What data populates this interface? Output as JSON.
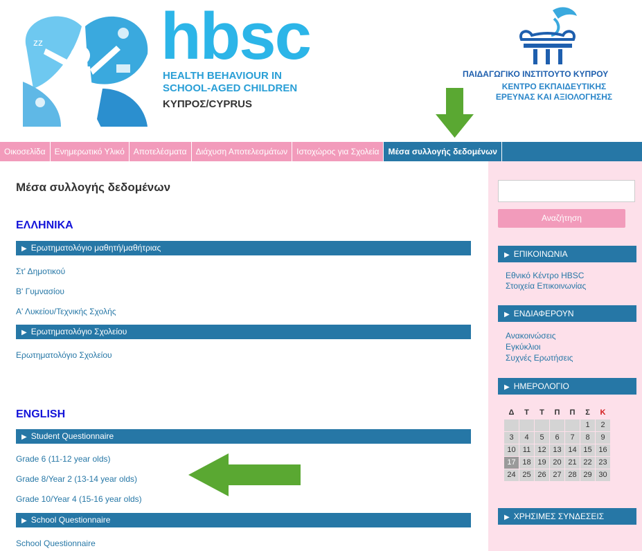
{
  "header": {
    "hbsc_word": "hbsc",
    "hbsc_sub1": "HEALTH BEHAVIOUR IN",
    "hbsc_sub2": "SCHOOL-AGED CHILDREN",
    "hbsc_country": "ΚΥΠΡΟΣ/CYPRUS",
    "pi_line1": "ΠΑΙΔΑΓΩΓΙΚΟ ΙΝΣΤΙΤΟΥΤΟ ΚΥΠΡΟΥ",
    "pi_line2": "ΚΕΝΤΡΟ ΕΚΠΑΙΔΕΥΤΙΚΗΣ",
    "pi_line3": "ΕΡΕΥΝΑΣ ΚΑΙ ΑΞΙΟΛΟΓΗΣΗΣ"
  },
  "nav": {
    "items": [
      {
        "label": "Οικοσελίδα"
      },
      {
        "label": "Ενημερωτικό Υλικό"
      },
      {
        "label": "Αποτελέσματα"
      },
      {
        "label": "Διάχυση Αποτελεσμάτων"
      },
      {
        "label": "Ιστοχώρος για Σχολεία"
      },
      {
        "label": "Μέσα συλλογής δεδομένων"
      }
    ]
  },
  "main": {
    "title": "Μέσα συλλογής δεδομένων",
    "greek": {
      "heading": "ΕΛΛΗΝΙΚΑ",
      "bar1": "Ερωτηματολόγιο μαθητή/μαθήτριας",
      "links1": [
        "Στ' Δημοτικού",
        "Β' Γυμνασίου",
        "Α' Λυκείου/Τεχνικής Σχολής"
      ],
      "bar2": "Ερωτηματολόγιο Σχολείου",
      "links2": [
        "Ερωτηματολόγιο Σχολείου"
      ]
    },
    "english": {
      "heading": "ENGLISH",
      "bar1": "Student Questionnaire",
      "links1": [
        "Grade 6 (11-12 year olds)",
        "Grade 8/Year 2 (13-14 year olds)",
        "Grade 10/Year 4 (15-16 year olds)"
      ],
      "bar2": "School Questionnaire",
      "links2": [
        "School Questionnaire"
      ]
    }
  },
  "sidebar": {
    "search_button": "Αναζήτηση",
    "contact": {
      "title": "ΕΠΙΚΟΙΝΩΝΙΑ",
      "links": [
        "Εθνικό Κέντρο HBSC",
        "Στοιχεία Επικοινωνίας"
      ]
    },
    "interest": {
      "title": "ΕΝΔΙΑΦΕΡΟΥΝ",
      "links": [
        "Ανακοινώσεις",
        "Εγκύκλιοι",
        "Συχνές Ερωτήσεις"
      ]
    },
    "calendar": {
      "title": "ΗΜΕΡΟΛΟΓΙΟ",
      "days": [
        "Δ",
        "Τ",
        "Τ",
        "Π",
        "Π",
        "Σ",
        "Κ"
      ],
      "weeks": [
        [
          "",
          "",
          "",
          "",
          "",
          "1",
          "2"
        ],
        [
          "3",
          "4",
          "5",
          "6",
          "7",
          "8",
          "9"
        ],
        [
          "10",
          "11",
          "12",
          "13",
          "14",
          "15",
          "16"
        ],
        [
          "17",
          "18",
          "19",
          "20",
          "21",
          "22",
          "23"
        ],
        [
          "24",
          "25",
          "26",
          "27",
          "28",
          "29",
          "30"
        ]
      ],
      "today": "17"
    },
    "useful": {
      "title": "ΧΡΗΣΙΜΕΣ ΣΥΝΔΕΣΕΙΣ"
    }
  },
  "colors": {
    "nav_pink": "#f29bbb",
    "nav_blue": "#2677a6",
    "link_blue": "#2677a6",
    "heading_blue": "#1414d9",
    "sidebar_bg": "#fde0ea",
    "arrow_green": "#5aa832"
  }
}
